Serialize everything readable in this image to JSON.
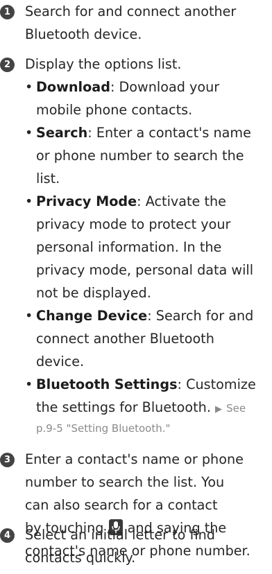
{
  "items": [
    {
      "number": "1",
      "lines": [
        "Search for and connect another",
        "Bluetooth device."
      ]
    },
    {
      "number": "2",
      "lines": [
        "Display the options list."
      ]
    },
    {
      "number": "3",
      "lines": [
        "Enter a contact's name or phone",
        "number to search the list. You",
        "can also search for a contact",
        "by touching",
        "and saying the",
        "contact's name or phone number."
      ]
    },
    {
      "number": "4",
      "lines": [
        "Select an initial letter to find",
        "contacts quickly."
      ]
    }
  ],
  "options": [
    {
      "term": "Download",
      "lines": [
        ": Download your",
        "mobile phone contacts."
      ]
    },
    {
      "term": "Search",
      "lines": [
        ": Enter a contact's name",
        "or phone number to search the",
        "list."
      ]
    },
    {
      "term": "Privacy Mode",
      "lines": [
        ": Activate the",
        "privacy mode to protect your",
        "personal information. In the",
        "privacy mode, personal data will",
        "not be displayed."
      ]
    },
    {
      "term": "Change Device",
      "lines": [
        ": Search for and",
        "connect another Bluetooth",
        "device."
      ]
    },
    {
      "term": "Bluetooth Settings",
      "lines": [
        ": Customize",
        "the settings for Bluetooth."
      ],
      "see_arrow": "▶",
      "see": "See",
      "see_ref": "p.9-5 \"Setting Bluetooth.\""
    }
  ],
  "icons": {
    "microphone": "microphone-icon"
  }
}
